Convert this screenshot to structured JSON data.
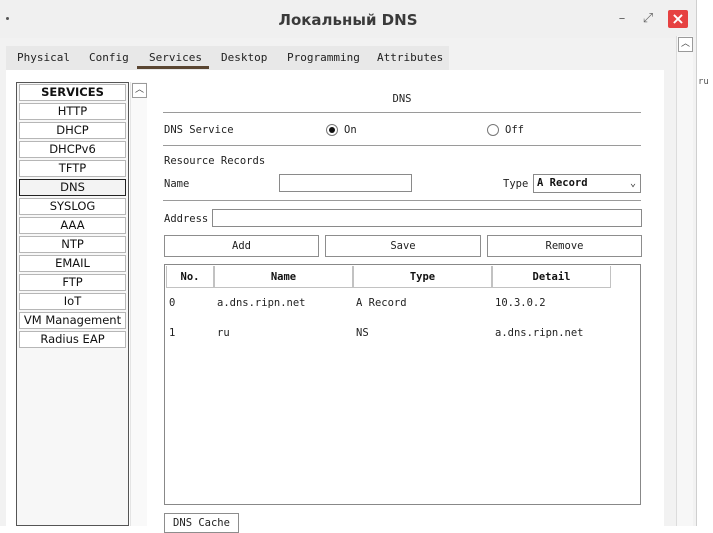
{
  "window": {
    "title": "Локальный DNS",
    "controls": {
      "minimize": "–",
      "maximize": "⤢",
      "close": "×"
    }
  },
  "bleed_text": "ru",
  "tabs": [
    {
      "label": "Physical"
    },
    {
      "label": "Config"
    },
    {
      "label": "Services",
      "active": true
    },
    {
      "label": "Desktop"
    },
    {
      "label": "Programming"
    },
    {
      "label": "Attributes"
    }
  ],
  "services": {
    "header": "SERVICES",
    "items": [
      "HTTP",
      "DHCP",
      "DHCPv6",
      "TFTP",
      "DNS",
      "SYSLOG",
      "AAA",
      "NTP",
      "EMAIL",
      "FTP",
      "IoT",
      "VM Management",
      "Radius EAP"
    ],
    "selected": "DNS"
  },
  "dns": {
    "title": "DNS",
    "service_label": "DNS Service",
    "on_label": "On",
    "off_label": "Off",
    "service_state": "On",
    "resource_records_label": "Resource Records",
    "name_label": "Name",
    "name_value": "",
    "type_label": "Type",
    "type_value": "A Record",
    "address_label": "Address",
    "address_value": "",
    "buttons": {
      "add": "Add",
      "save": "Save",
      "remove": "Remove"
    },
    "table": {
      "columns": [
        "No.",
        "Name",
        "Type",
        "Detail"
      ],
      "rows": [
        [
          "0",
          "a.dns.ripn.net",
          "A Record",
          "10.3.0.2"
        ],
        [
          "1",
          "ru",
          "NS",
          "a.dns.ripn.net"
        ]
      ]
    },
    "cache_button": "DNS Cache"
  },
  "colors": {
    "close_button": "#e64141",
    "active_tab_underline": "#5a4632"
  }
}
